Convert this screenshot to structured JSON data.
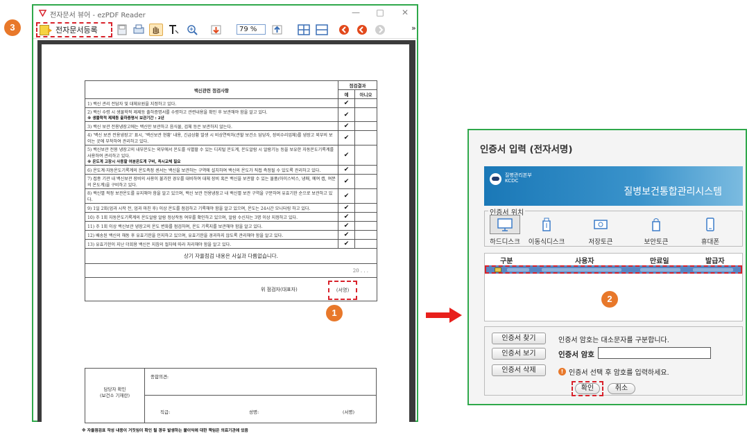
{
  "reader": {
    "title": "전자문서 뷰어 - ezPDF Reader",
    "register_label": "전자문서등록",
    "zoom": "79 %",
    "window_controls": {
      "minimize": "—",
      "maximize": "□",
      "close": "✕"
    },
    "overflow": "»"
  },
  "checklist": {
    "header_item": "백신관련 점검사항",
    "header_result": "점검결과",
    "header_yes": "예",
    "header_no": "아니오",
    "mark": "✔",
    "items": [
      "1) 백신 관리 전담자 및 대체요원을 지정하고 있다.",
      "2) 백신 수령 시 생물학적 제제등 출하증명서를 수령하고 관련내용을 확인 후 보관해야 함을 알고 있다.",
      "3) 백신 보관 전용냉장고에는 백신만 보관하고 음식물, 검체 등은 보관하지 않는다.",
      "4) '백신 보관 전용냉장고' 표시, '백신보관 현황' 내용, 긴급상황 발생 시 비상연락처(관할 보건소 담당자, 장비수리업체)를 냉장고 외부의 보이는 곳에 부착하여 관리하고 있다.",
      "5) 백신보관 전용 냉장고의 내부온도는 외부에서 온도를 식별할 수 있는 디지털 온도계, 온도알람 시 알람기능 등을 보유한 자동온도기록계를 사용하여 관리하고 있다.",
      "6) 온도계·자동온도기록계의 온도측정 센서는 백신을 보관하는 구역에 설치하여 백신의 온도가 직접 측정될 수 있도록 관리하고 있다.",
      "7) 접종 기관 내 백신보관 장비의 사용이 불가한 경우를 대비하여 대체 장비 혹은 백신을 보관할 수 있는 물품(아이스박스, 냉매, 예여 캡, 여분의 온도계)을 구비하고 있다.",
      "8) 백신별 적정 보관온도를 유지해야 함을 알고 있으며, 백신 보관 전용냉장고 내 백신별 보관 구역을 구분하여 유효기한 순으로 보관하고 있다.",
      "9) 1일 2회(업과 시작 전, 업과 마친 후) 이상 온도를 점검하고 기록해야 함을 알고 있으며, 온도는 24시간 모니터링 하고 있다.",
      "10) 주 1회 자동온도기록계의 온도알람 알람 정상작동 여부를 확인하고 있으며, 알람 수신자는 3명 이상 지정하고 있다.",
      "11) 주 1회 이상 백신보관 냉장고의 온도 변화를 점검하며, 온도 기록지를 보관해야 함을 알고 있다.",
      "12) 배송된 백신의 해동 후 유효기한을 인지하고 있으며, 유효기한을 경과하지 않도록 관리해야 함을 알고 있다.",
      "13) 유효기한이 지난 더회용 백신은 지침의 절차에 따라 처리해야 함을 알고 있다."
    ],
    "note_item2": "※ 생물학적 제제등 출하증명서 보관기간 : 2년",
    "note_item4": "※ 온도계 고장시 사용할 여분온도계 구비, 즉시교체 필요",
    "declaration": "상기 자율점검 내용은 사실과 다름없습니다.",
    "date": "20   .  .  .",
    "inspector": "위 점검자(대표자)",
    "sign_mark": "(서명)"
  },
  "officer": {
    "title": "담당자 확인\n(보건소 기재란)",
    "opinion": "종합의견:",
    "position": "직급:",
    "name": "성명:",
    "sign": "(서명)"
  },
  "footnote": "※ 자율점검표 작성 내용이 거짓임이 확인 될 경우 발생하는 불이익에 대한 책임은 의료기관에 있음",
  "badges": {
    "one": "1",
    "two": "2",
    "three": "3"
  },
  "dialog": {
    "title": "인증서 입력 (전자서명)",
    "org_ko": "질병관리본부",
    "org_en": "KCDC",
    "system_name": "질병보건통합관리시스템",
    "location_legend": "인증서 위치",
    "locations": [
      "하드디스크",
      "이동식디스크",
      "저장토큰",
      "보안토큰",
      "휴대폰"
    ],
    "columns": [
      "구분",
      "사용자",
      "만료일",
      "발급자"
    ],
    "find_button": "인증서 찾기",
    "view_button": "인증서 보기",
    "delete_button": "인증서 삭제",
    "case_hint": "인증서 암호는 대소문자를 구분합니다.",
    "password_label": "인증서 암호",
    "password_value": "",
    "warning": "인증서 선택 후 암호를 입력하세요.",
    "ok_button": "확인",
    "cancel_button": "취소"
  },
  "colors": {
    "frame": "#2ea84a",
    "highlight": "#d8212a",
    "badge": "#e8782a",
    "arrow": "#e8201c"
  }
}
